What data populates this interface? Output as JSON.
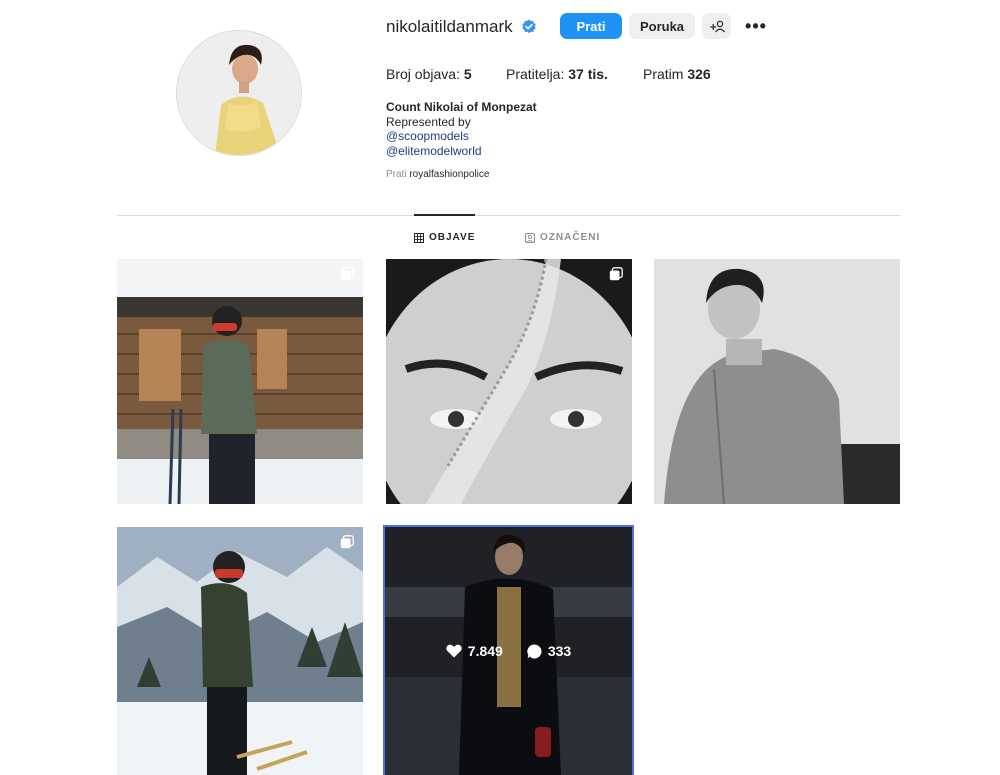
{
  "profile": {
    "username": "nikolaitildanmark",
    "follow_label": "Prati",
    "message_label": "Poruka",
    "suggest_label": "+",
    "more_label": "•••",
    "stats": [
      {
        "label": "Broj objava:",
        "value": "5"
      },
      {
        "label": "Pratitelja:",
        "value": "37 tis."
      },
      {
        "label": "Pratim",
        "value": "326"
      }
    ],
    "bio": {
      "name": "Count Nikolai of Monpezat",
      "line1": "Represented by",
      "link1": "@scoopmodels",
      "link2": "@elitemodelworld"
    },
    "followed_by": {
      "prefix": "Prati",
      "account": "royalfashionpolice"
    }
  },
  "tabs": [
    {
      "label": "OBJAVE",
      "active": true
    },
    {
      "label": "OZNAČENI",
      "active": false
    }
  ],
  "posts": [
    {
      "kind": "multi",
      "scene": "skier-cabin"
    },
    {
      "kind": "multi",
      "scene": "face-crystals"
    },
    {
      "kind": "single",
      "scene": "bw-portrait"
    },
    {
      "kind": "multi",
      "scene": "skier-mountain"
    },
    {
      "kind": "single",
      "scene": "runway",
      "hover": {
        "likes": "7.849",
        "comments": "333"
      }
    }
  ],
  "colors": {
    "accent": "#1e93f5",
    "verified": "#3897f0",
    "link": "#1c3f7a",
    "hover_outline": "#4d6fe0"
  }
}
